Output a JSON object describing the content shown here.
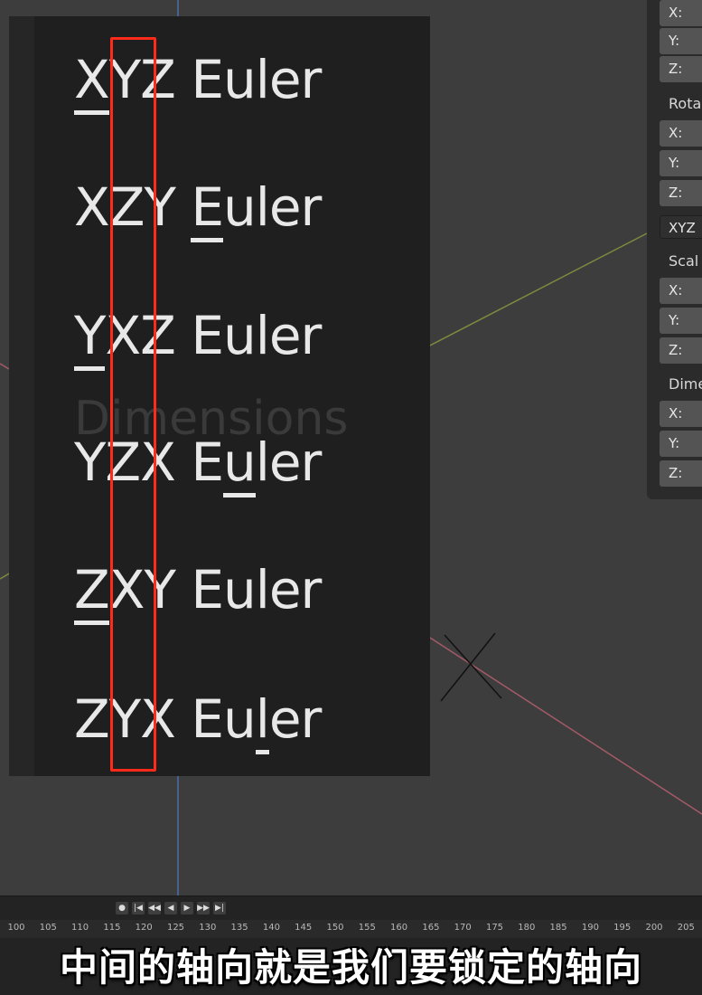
{
  "menu": {
    "items": [
      {
        "pre": "",
        "u": "X",
        "post": "YZ Euler"
      },
      {
        "pre": "XZY ",
        "u": "E",
        "post": "uler"
      },
      {
        "pre": "",
        "u": "Y",
        "post": "XZ Euler"
      },
      {
        "pre": "YZX E",
        "u": "u",
        "post": "ler"
      },
      {
        "pre": "",
        "u": "Z",
        "post": "XY Euler"
      },
      {
        "pre": "ZYX Eu",
        "u": "l",
        "post": "er"
      }
    ],
    "background_text": "Dimensions",
    "highlight_color": "#ff2a1a"
  },
  "properties": {
    "loc_x": "X:",
    "loc_y": "Y:",
    "loc_z": "Z:",
    "rotation_label": "Rota",
    "rot_x": "X:",
    "rot_y": "Y:",
    "rot_z": "Z:",
    "rotation_mode": "XYZ",
    "scale_label": "Scal",
    "scale_x": "X:",
    "scale_y": "Y:",
    "scale_z": "Z:",
    "dimensions_label": "Dime",
    "dim_x": "X:",
    "dim_y": "Y:",
    "dim_z": "Z:"
  },
  "timeline": {
    "ticks": [
      "100",
      "105",
      "110",
      "115",
      "120",
      "125",
      "130",
      "135",
      "140",
      "145",
      "150",
      "155",
      "160",
      "165",
      "170",
      "175",
      "180",
      "185",
      "190",
      "195",
      "200",
      "205"
    ],
    "controls": [
      "●",
      "|◀",
      "◀◀",
      "◀",
      "▶",
      "▶▶",
      "▶|"
    ]
  },
  "caption": "中间的轴向就是我们要锁定的轴向"
}
